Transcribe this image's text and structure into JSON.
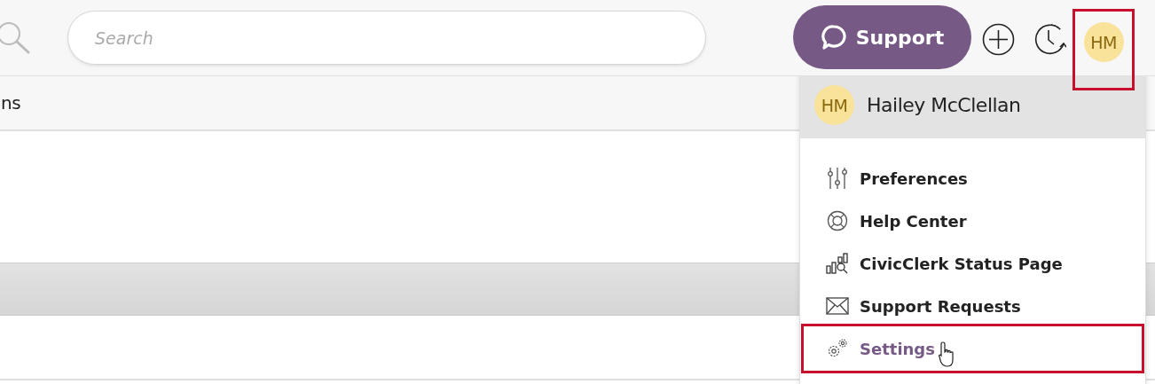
{
  "search": {
    "placeholder": "Search"
  },
  "support_button": {
    "label": "Support"
  },
  "avatar_button": {
    "initials": "HM",
    "highlighted": true
  },
  "section_tab": {
    "label": "ns"
  },
  "user_menu": {
    "initials": "HM",
    "name": "Hailey McClellan",
    "items": [
      {
        "kind": "preferences",
        "label": "Preferences",
        "selected": false,
        "highlighted": false
      },
      {
        "kind": "help",
        "label": "Help Center",
        "selected": false,
        "highlighted": false
      },
      {
        "kind": "status",
        "label": "CivicClerk Status Page",
        "selected": false,
        "highlighted": false
      },
      {
        "kind": "requests",
        "label": "Support Requests",
        "selected": false,
        "highlighted": false
      },
      {
        "kind": "settings",
        "label": "Settings",
        "selected": true,
        "highlighted": true
      }
    ]
  }
}
